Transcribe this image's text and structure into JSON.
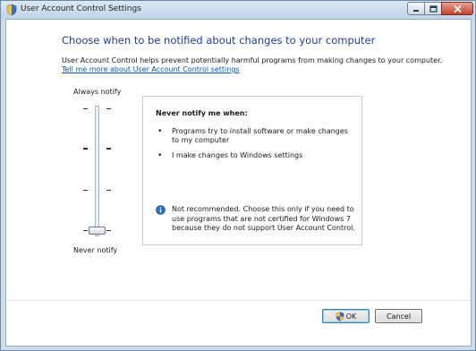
{
  "window": {
    "title": "User Account Control Settings"
  },
  "main": {
    "heading": "Choose when to be notified about changes to your computer",
    "description": "User Account Control helps prevent potentially harmful programs from making changes to your computer.",
    "learn_more_link": "Tell me more about User Account Control settings"
  },
  "slider": {
    "top_label": "Always notify",
    "bottom_label": "Never notify",
    "levels": 4,
    "selected_level": 1
  },
  "info": {
    "title": "Never notify me when:",
    "bullets": [
      "Programs try to install software or make changes to my computer",
      "I make changes to Windows settings"
    ],
    "note": "Not recommended. Choose this only if you need to use programs that are not certified for Windows 7 because they do not support User Account Control."
  },
  "buttons": {
    "ok": "OK",
    "cancel": "Cancel"
  },
  "icons": {
    "title_icon": "uac-shield-icon",
    "note_icon": "info-icon",
    "ok_icon": "uac-shield-icon"
  },
  "colors": {
    "heading": "#1f3d99",
    "link": "#0a58b8"
  }
}
